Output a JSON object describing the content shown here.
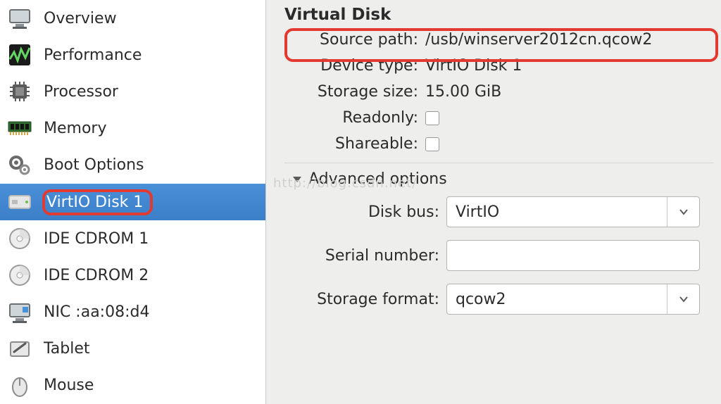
{
  "sidebar": {
    "items": [
      {
        "label": "Overview"
      },
      {
        "label": "Performance"
      },
      {
        "label": "Processor"
      },
      {
        "label": "Memory"
      },
      {
        "label": "Boot Options"
      },
      {
        "label": "VirtIO Disk 1"
      },
      {
        "label": "IDE CDROM 1"
      },
      {
        "label": "IDE CDROM 2"
      },
      {
        "label": "NIC :aa:08:d4"
      },
      {
        "label": "Tablet"
      },
      {
        "label": "Mouse"
      }
    ]
  },
  "panel": {
    "title": "Virtual Disk",
    "source_path_label": "Source path:",
    "source_path_value": "/usb/winserver2012cn.qcow2",
    "device_type_label": "Device type:",
    "device_type_value": "VirtIO Disk 1",
    "storage_size_label": "Storage size:",
    "storage_size_value": "15.00 GiB",
    "readonly_label": "Readonly:",
    "shareable_label": "Shareable:",
    "advanced_label": "Advanced options",
    "disk_bus_label": "Disk bus:",
    "disk_bus_value": "VirtIO",
    "serial_label": "Serial number:",
    "serial_value": "",
    "storage_format_label": "Storage format:",
    "storage_format_value": "qcow2"
  },
  "watermark": "http://blog.csdn.net/"
}
